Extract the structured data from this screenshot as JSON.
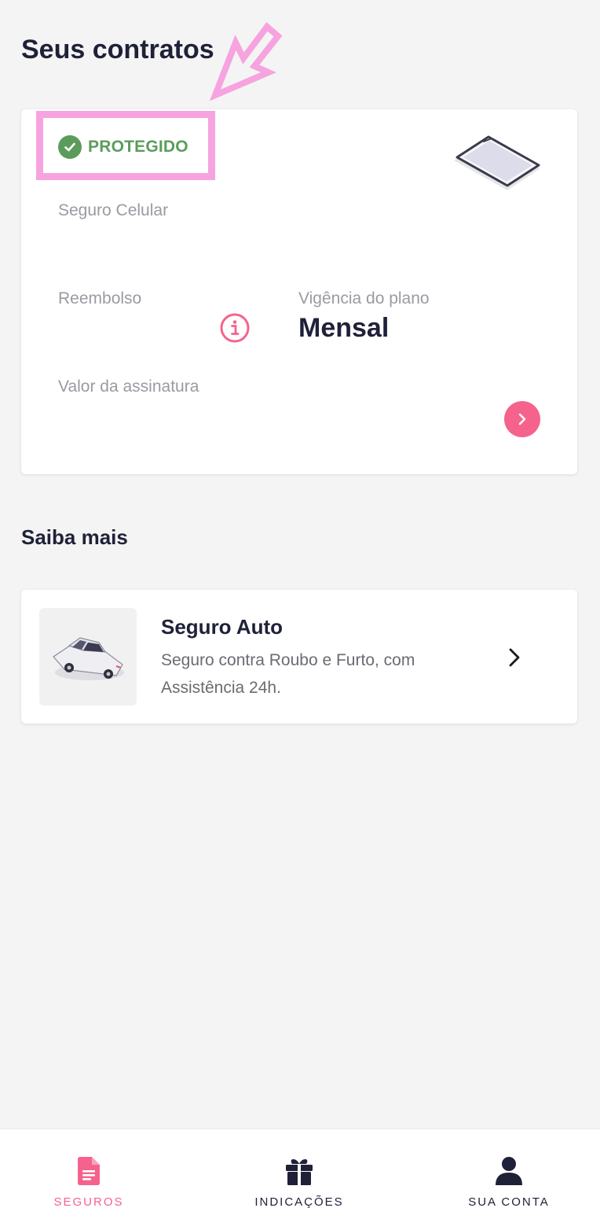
{
  "header": {
    "title": "Seus contratos"
  },
  "contract": {
    "status": "PROTEGIDO",
    "product": "Seguro Celular",
    "reembolso_label": "Reembolso",
    "vigencia_label": "Vigência do plano",
    "vigencia_value": "Mensal",
    "valor_label": "Valor da assinatura"
  },
  "section": {
    "title": "Saiba mais"
  },
  "promo": {
    "title": "Seguro Auto",
    "description": "Seguro contra Roubo e Furto, com Assistência 24h."
  },
  "nav": [
    {
      "label": "SEGUROS",
      "icon": "document-icon",
      "active": true
    },
    {
      "label": "INDICAÇÕES",
      "icon": "gift-icon",
      "active": false
    },
    {
      "label": "SUA CONTA",
      "icon": "person-icon",
      "active": false
    }
  ],
  "colors": {
    "accent": "#f5638d",
    "success": "#5b9c5d",
    "annotation": "#f6a3df",
    "text_dark": "#1f2138",
    "text_muted": "#9a9aa2"
  }
}
